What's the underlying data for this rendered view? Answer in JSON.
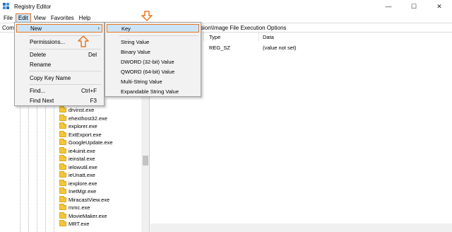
{
  "window": {
    "title": "Registry Editor",
    "controls": {
      "minimize": "—",
      "maximize": "☐",
      "close": "✕"
    }
  },
  "menubar": [
    "File",
    "Edit",
    "View",
    "Favorites",
    "Help"
  ],
  "address": {
    "left": "Com",
    "right": "sion\\Image File Execution Options"
  },
  "edit_menu": {
    "new": "New",
    "new_arrow": "›",
    "permissions": "Permissions...",
    "delete": "Delete",
    "delete_shortcut": "Del",
    "rename": "Rename",
    "copy_key_name": "Copy Key Name",
    "find": "Find...",
    "find_shortcut": "Ctrl+F",
    "find_next": "Find Next",
    "find_next_shortcut": "F3"
  },
  "new_submenu": {
    "key": "Key",
    "string_value": "String Value",
    "binary_value": "Binary Value",
    "dword_value": "DWORD (32-bit) Value",
    "qword_value": "QWORD (64-bit) Value",
    "multi_string_value": "Multi-String Value",
    "expandable_string_value": "Expandable String Value"
  },
  "values_pane": {
    "columns": [
      "Type",
      "Data"
    ],
    "rows": [
      {
        "type": "REG_SZ",
        "data": "(value not set)"
      }
    ]
  },
  "tree": {
    "items": [
      "drvinst.exe",
      "ehexthost32.exe",
      "explorer.exe",
      "ExtExport.exe",
      "GoogleUpdate.exe",
      "ie4uinit.exe",
      "ieinstal.exe",
      "ielowutil.exe",
      "ieUnatt.exe",
      "iexplore.exe",
      "InetMgr.exe",
      "MiracastView.exe",
      "mmc.exe",
      "MovieMaker.exe",
      "MRT.exe"
    ]
  },
  "colors": {
    "highlight": "#cce4f7",
    "annotation_orange": "#e87722",
    "folder": "#f5c63a"
  },
  "icons": [
    "registry-editor-icon",
    "folder-icon",
    "orange-arrow-icon",
    "submenu-arrow-icon"
  ]
}
